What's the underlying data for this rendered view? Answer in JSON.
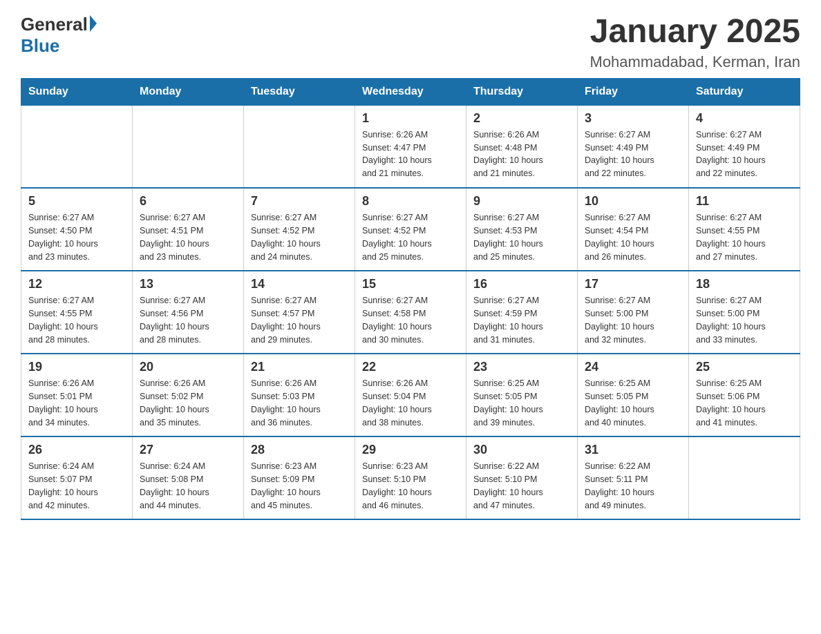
{
  "header": {
    "logo_general": "General",
    "logo_blue": "Blue",
    "title": "January 2025",
    "subtitle": "Mohammadabad, Kerman, Iran"
  },
  "weekdays": [
    "Sunday",
    "Monday",
    "Tuesday",
    "Wednesday",
    "Thursday",
    "Friday",
    "Saturday"
  ],
  "weeks": [
    [
      {
        "day": "",
        "info": ""
      },
      {
        "day": "",
        "info": ""
      },
      {
        "day": "",
        "info": ""
      },
      {
        "day": "1",
        "info": "Sunrise: 6:26 AM\nSunset: 4:47 PM\nDaylight: 10 hours\nand 21 minutes."
      },
      {
        "day": "2",
        "info": "Sunrise: 6:26 AM\nSunset: 4:48 PM\nDaylight: 10 hours\nand 21 minutes."
      },
      {
        "day": "3",
        "info": "Sunrise: 6:27 AM\nSunset: 4:49 PM\nDaylight: 10 hours\nand 22 minutes."
      },
      {
        "day": "4",
        "info": "Sunrise: 6:27 AM\nSunset: 4:49 PM\nDaylight: 10 hours\nand 22 minutes."
      }
    ],
    [
      {
        "day": "5",
        "info": "Sunrise: 6:27 AM\nSunset: 4:50 PM\nDaylight: 10 hours\nand 23 minutes."
      },
      {
        "day": "6",
        "info": "Sunrise: 6:27 AM\nSunset: 4:51 PM\nDaylight: 10 hours\nand 23 minutes."
      },
      {
        "day": "7",
        "info": "Sunrise: 6:27 AM\nSunset: 4:52 PM\nDaylight: 10 hours\nand 24 minutes."
      },
      {
        "day": "8",
        "info": "Sunrise: 6:27 AM\nSunset: 4:52 PM\nDaylight: 10 hours\nand 25 minutes."
      },
      {
        "day": "9",
        "info": "Sunrise: 6:27 AM\nSunset: 4:53 PM\nDaylight: 10 hours\nand 25 minutes."
      },
      {
        "day": "10",
        "info": "Sunrise: 6:27 AM\nSunset: 4:54 PM\nDaylight: 10 hours\nand 26 minutes."
      },
      {
        "day": "11",
        "info": "Sunrise: 6:27 AM\nSunset: 4:55 PM\nDaylight: 10 hours\nand 27 minutes."
      }
    ],
    [
      {
        "day": "12",
        "info": "Sunrise: 6:27 AM\nSunset: 4:55 PM\nDaylight: 10 hours\nand 28 minutes."
      },
      {
        "day": "13",
        "info": "Sunrise: 6:27 AM\nSunset: 4:56 PM\nDaylight: 10 hours\nand 28 minutes."
      },
      {
        "day": "14",
        "info": "Sunrise: 6:27 AM\nSunset: 4:57 PM\nDaylight: 10 hours\nand 29 minutes."
      },
      {
        "day": "15",
        "info": "Sunrise: 6:27 AM\nSunset: 4:58 PM\nDaylight: 10 hours\nand 30 minutes."
      },
      {
        "day": "16",
        "info": "Sunrise: 6:27 AM\nSunset: 4:59 PM\nDaylight: 10 hours\nand 31 minutes."
      },
      {
        "day": "17",
        "info": "Sunrise: 6:27 AM\nSunset: 5:00 PM\nDaylight: 10 hours\nand 32 minutes."
      },
      {
        "day": "18",
        "info": "Sunrise: 6:27 AM\nSunset: 5:00 PM\nDaylight: 10 hours\nand 33 minutes."
      }
    ],
    [
      {
        "day": "19",
        "info": "Sunrise: 6:26 AM\nSunset: 5:01 PM\nDaylight: 10 hours\nand 34 minutes."
      },
      {
        "day": "20",
        "info": "Sunrise: 6:26 AM\nSunset: 5:02 PM\nDaylight: 10 hours\nand 35 minutes."
      },
      {
        "day": "21",
        "info": "Sunrise: 6:26 AM\nSunset: 5:03 PM\nDaylight: 10 hours\nand 36 minutes."
      },
      {
        "day": "22",
        "info": "Sunrise: 6:26 AM\nSunset: 5:04 PM\nDaylight: 10 hours\nand 38 minutes."
      },
      {
        "day": "23",
        "info": "Sunrise: 6:25 AM\nSunset: 5:05 PM\nDaylight: 10 hours\nand 39 minutes."
      },
      {
        "day": "24",
        "info": "Sunrise: 6:25 AM\nSunset: 5:05 PM\nDaylight: 10 hours\nand 40 minutes."
      },
      {
        "day": "25",
        "info": "Sunrise: 6:25 AM\nSunset: 5:06 PM\nDaylight: 10 hours\nand 41 minutes."
      }
    ],
    [
      {
        "day": "26",
        "info": "Sunrise: 6:24 AM\nSunset: 5:07 PM\nDaylight: 10 hours\nand 42 minutes."
      },
      {
        "day": "27",
        "info": "Sunrise: 6:24 AM\nSunset: 5:08 PM\nDaylight: 10 hours\nand 44 minutes."
      },
      {
        "day": "28",
        "info": "Sunrise: 6:23 AM\nSunset: 5:09 PM\nDaylight: 10 hours\nand 45 minutes."
      },
      {
        "day": "29",
        "info": "Sunrise: 6:23 AM\nSunset: 5:10 PM\nDaylight: 10 hours\nand 46 minutes."
      },
      {
        "day": "30",
        "info": "Sunrise: 6:22 AM\nSunset: 5:10 PM\nDaylight: 10 hours\nand 47 minutes."
      },
      {
        "day": "31",
        "info": "Sunrise: 6:22 AM\nSunset: 5:11 PM\nDaylight: 10 hours\nand 49 minutes."
      },
      {
        "day": "",
        "info": ""
      }
    ]
  ]
}
